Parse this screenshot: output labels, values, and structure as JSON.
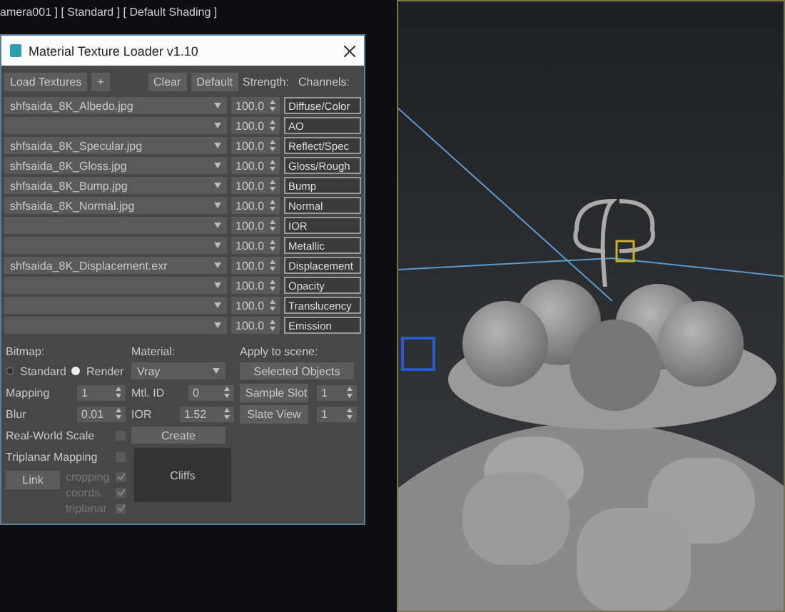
{
  "viewport_label": "amera001 ] [ Standard ] [ Default Shading ]",
  "dialog": {
    "title": "Material Texture Loader v1.10",
    "toolbar": {
      "load_button": "Load Textures",
      "add_button": "+",
      "clear_button": "Clear",
      "default_button": "Default",
      "strength_header": "Strength:",
      "channels_header": "Channels:"
    },
    "rows": [
      {
        "file": "shfsaida_8K_Albedo.jpg",
        "strength": "100.0",
        "channel": "Diffuse/Color"
      },
      {
        "strength": "100.0",
        "channel": "AO"
      },
      {
        "file": "shfsaida_8K_Specular.jpg",
        "strength": "100.0",
        "channel": "Reflect/Spec"
      },
      {
        "file": "shfsaida_8K_Gloss.jpg",
        "strength": "100.0",
        "channel": "Gloss/Rough"
      },
      {
        "file": "shfsaida_8K_Bump.jpg",
        "strength": "100.0",
        "channel": "Bump"
      },
      {
        "file": "shfsaida_8K_Normal.jpg",
        "strength": "100.0",
        "channel": "Normal"
      },
      {
        "strength": "100.0",
        "channel": "IOR"
      },
      {
        "strength": "100.0",
        "channel": "Metallic"
      },
      {
        "file": "shfsaida_8K_Displacement.exr",
        "strength": "100.0",
        "channel": "Displacement"
      },
      {
        "strength": "100.0",
        "channel": "Opacity"
      },
      {
        "strength": "100.0",
        "channel": "Translucency"
      },
      {
        "strength": "100.0",
        "channel": "Emission"
      }
    ],
    "bitmap": {
      "label": "Bitmap:",
      "options": [
        {
          "label": "Standard",
          "selected": false
        },
        {
          "label": "Render",
          "selected": true
        }
      ],
      "mapping": {
        "label": "Mapping",
        "value": "1"
      },
      "blur": {
        "label": "Blur",
        "value": "0.01"
      },
      "checks": [
        {
          "label": "Real-World Scale",
          "checked": false
        },
        {
          "label": "Triplanar Mapping",
          "checked": false
        }
      ],
      "link_button": "Link",
      "link_options": [
        {
          "label": "cropping",
          "checked": true,
          "disabled": true
        },
        {
          "label": "coords.",
          "checked": true,
          "disabled": true
        },
        {
          "label": "triplanar",
          "checked": true,
          "disabled": true
        }
      ]
    },
    "material": {
      "label": "Material:",
      "renderer": "Vray",
      "mtl_id": {
        "label": "Mtl. ID",
        "value": "0"
      },
      "ior": {
        "label": "IOR",
        "value": "1.52"
      },
      "create_button": "Create",
      "preview": "Cliffs"
    },
    "apply": {
      "label": "Apply to scene:",
      "selected_objects_button": "Selected Objects",
      "sample_slot": {
        "label": "Sample Slot",
        "value": "1"
      },
      "slate_view": {
        "label": "Slate View",
        "value": "1"
      }
    }
  }
}
